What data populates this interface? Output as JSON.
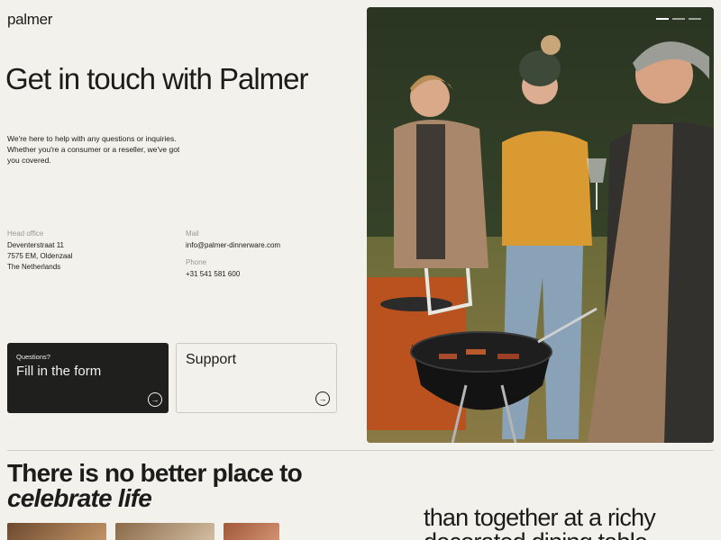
{
  "brand": {
    "logo": "palmer"
  },
  "hero": {
    "title": "Get in touch with Palmer",
    "subtitle": "We're here to help with any questions or inquiries. Whether you're a consumer or a reseller, we've got you covered."
  },
  "contact": {
    "office_label": "Head office",
    "office_lines": [
      "Deventerstraat 11",
      "7575 EM, Oldenzaal",
      "The Netherlands"
    ],
    "mail_label": "Mail",
    "mail_value": "info@palmer-dinnerware.com",
    "phone_label": "Phone",
    "phone_value": "+31 541 581 600"
  },
  "cards": {
    "form": {
      "kicker": "Questions?",
      "title": "Fill in the form"
    },
    "support": {
      "title": "Support"
    }
  },
  "gallery": {
    "slide_count": 3,
    "active_slide": 1
  },
  "section": {
    "headline": "There is no better place to",
    "headline_italic": "celebrate life",
    "tagline": "than together at a richy decorated dining table"
  },
  "colors": {
    "background": "#f2f1eb",
    "dark_card": "#1f1f1d",
    "text": "#1c1c1a"
  },
  "icons": {
    "card_arrow": "arrow-right-icon"
  }
}
